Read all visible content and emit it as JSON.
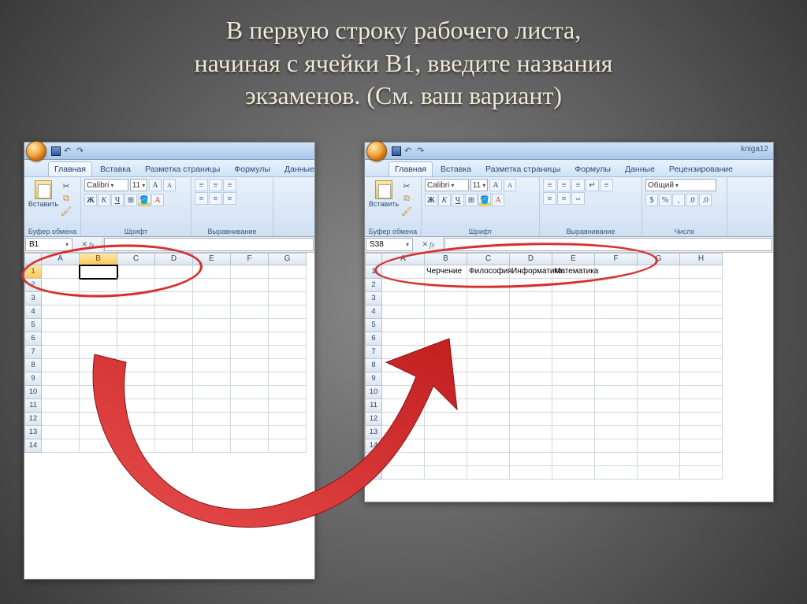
{
  "title_line1": "В первую строку рабочего листа,",
  "title_line2": "начиная с ячейки B1, введите названия",
  "title_line3": "экзаменов. (См. ваш вариант)",
  "ribbon": {
    "tabs": [
      "Главная",
      "Вставка",
      "Разметка страницы",
      "Формулы",
      "Данные",
      "Рецензирование"
    ],
    "groups": {
      "clipboard": "Буфер обмена",
      "font": "Шрифт",
      "align": "Выравнивание",
      "number": "Число"
    },
    "paste": "Вставить",
    "font_name": "Calibri",
    "font_size": "11",
    "number_format": "Общий",
    "bold": "Ж",
    "italic": "К",
    "underline": "Ч"
  },
  "left": {
    "doc_title": "",
    "namebox": "B1",
    "columns": [
      "A",
      "B",
      "C",
      "D",
      "E",
      "F",
      "G"
    ],
    "rows": [
      "1",
      "2",
      "3",
      "4",
      "5",
      "6",
      "7",
      "8",
      "9",
      "10",
      "11",
      "12",
      "13",
      "14"
    ],
    "selected": {
      "col": "B",
      "row": "1"
    }
  },
  "right": {
    "doc_title": "kniga12",
    "namebox": "S38",
    "columns": [
      "A",
      "B",
      "C",
      "D",
      "E",
      "F",
      "G",
      "H"
    ],
    "rows": [
      "1",
      "2",
      "3",
      "4",
      "5",
      "6",
      "7",
      "8",
      "9",
      "10",
      "11",
      "12",
      "13",
      "14",
      "15",
      "16"
    ],
    "row1": {
      "B": "Черчение",
      "C": "Философия",
      "D": "Информатика",
      "E": "Математика"
    }
  }
}
